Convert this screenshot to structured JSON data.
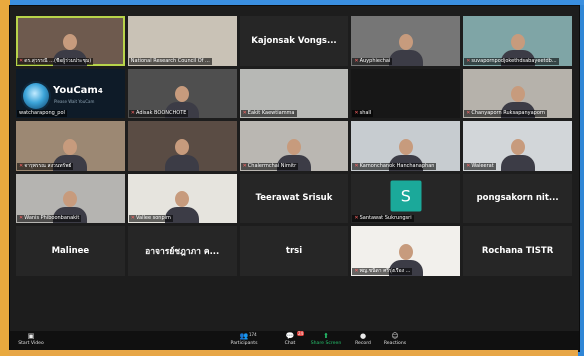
{
  "participants": [
    {
      "name": "ดร.สุวรรณี ...(ชื่อผู้ร่วมประชุม)",
      "display": "label",
      "muted": true,
      "bg": "#6e5a4e",
      "active": true,
      "person": true
    },
    {
      "name": "National Research Council Of ...",
      "display": "label",
      "muted": false,
      "bg": "#c9c2b6",
      "person": false
    },
    {
      "name": "Kajonsak Vongs...",
      "display": "center",
      "muted": false,
      "bg": "#262626"
    },
    {
      "name": "Auyphiechai",
      "display": "label",
      "muted": true,
      "bg": "#767676",
      "person": true
    },
    {
      "name": "suvapornpodjokethdsabayeetdb...",
      "display": "label",
      "muted": true,
      "bg": "#7fa5a6",
      "person": true
    },
    {
      "name": "watcharapong_pol",
      "display": "youcam",
      "muted": false,
      "bg": "#0e1b28"
    },
    {
      "name": "Adisak BOONCHOTE",
      "display": "label",
      "muted": true,
      "bg": "#4f4f4f",
      "person": true
    },
    {
      "name": "Eakit Kaewtiamma",
      "display": "label",
      "muted": true,
      "bg": "#b7b8b5",
      "person": false
    },
    {
      "name": "shall",
      "display": "label",
      "muted": true,
      "bg": "#171717",
      "person": false
    },
    {
      "name": "Chanyaporn Ruksapanyaporn",
      "display": "label",
      "muted": true,
      "bg": "#b6b2ab",
      "person": true
    },
    {
      "name": "จารุพรรณ สงวนทรัพย์",
      "display": "label",
      "muted": true,
      "bg": "#9c8873",
      "person": true
    },
    {
      "name": "",
      "display": "label",
      "muted": false,
      "bg": "#5a4c44",
      "person": true
    },
    {
      "name": "Chalermchai Nimitr",
      "display": "label",
      "muted": true,
      "bg": "#bab7b2",
      "person": true
    },
    {
      "name": "Kamonchanok Hanchanaphan",
      "display": "label",
      "muted": true,
      "bg": "#c7ccd0",
      "person": true
    },
    {
      "name": "Waleerat",
      "display": "label",
      "muted": true,
      "bg": "#d2d6d9",
      "person": true
    },
    {
      "name": "Wanis Phiboonbanakit",
      "display": "label",
      "muted": true,
      "bg": "#b5b4b1",
      "person": true
    },
    {
      "name": "Vallee sonpim",
      "display": "label",
      "muted": true,
      "bg": "#e6e4de",
      "person": true
    },
    {
      "name": "Teerawat Srisuk",
      "display": "center",
      "muted": false,
      "bg": "#262626"
    },
    {
      "name": "Santawat Sukrungsri",
      "display": "avatar",
      "initial": "S",
      "muted": true,
      "bg": "#262626"
    },
    {
      "name": "pongsakorn nit...",
      "display": "center",
      "muted": false,
      "bg": "#262626"
    },
    {
      "name": "Malinee",
      "display": "center",
      "muted": false,
      "bg": "#262626"
    },
    {
      "name": "อาจารย์ชฎาภา ค...",
      "display": "center",
      "muted": false,
      "bg": "#262626"
    },
    {
      "name": "trsi",
      "display": "center",
      "muted": false,
      "bg": "#262626"
    },
    {
      "name": "พญ.ชนิดา ศรีรุ่งเรือง ...",
      "display": "label",
      "muted": true,
      "bg": "#f2f0ec",
      "person": true
    },
    {
      "name": "Rochana TISTR",
      "display": "center",
      "muted": false,
      "bg": "#262626"
    }
  ],
  "youcam": {
    "brand": "YouCam",
    "version": "4",
    "sub": "Please Wait YouCam"
  },
  "toolbar": {
    "start_video": "Start Video",
    "participants_label": "Participants",
    "participants_count": "174",
    "chat": "Chat",
    "chat_badge": "24",
    "share": "Share Screen",
    "record": "Record",
    "reactions": "Reactions"
  },
  "colors": {
    "accent_share": "#25c06c",
    "active_border": "#b8d44a",
    "avatar": "#1ba99a"
  }
}
